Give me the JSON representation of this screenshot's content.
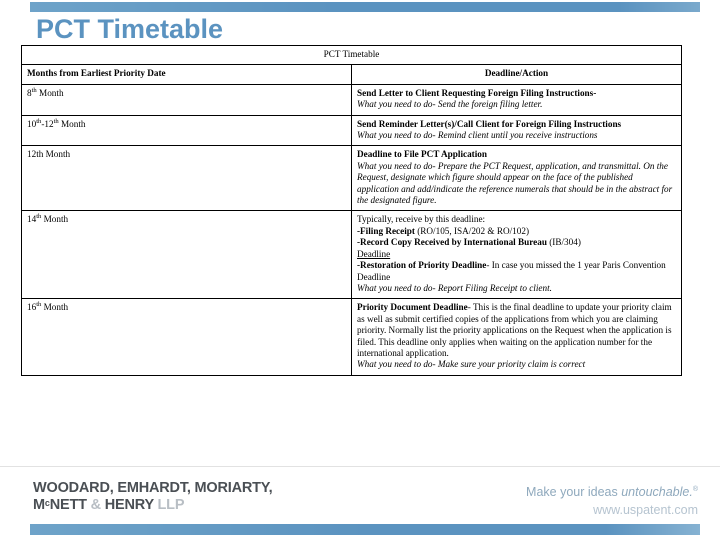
{
  "slide": {
    "title": "PCT Timetable",
    "accent_color": "#5b93c0"
  },
  "table": {
    "caption": "PCT Timetable",
    "headers": {
      "col1": "Months from Earliest Priority Date",
      "col2": "Deadline/Action"
    },
    "rows": [
      {
        "month_num": "8",
        "month_sup": "th",
        "month_suffix": " Month",
        "bold_heading": "Send Letter to Client Requesting Foreign Filing Instructions-",
        "italic_line": "What you need to do- Send the foreign filing letter."
      },
      {
        "month_num": "10",
        "month_sup": "th",
        "month_num2": "-12",
        "month_sup2": "th",
        "month_suffix": " Month",
        "bold_heading": "Send Reminder Letter(s)/Call Client for Foreign Filing Instructions",
        "italic_line": "What you need to do- Remind client until you receive instructions"
      },
      {
        "month_num": "12th",
        "month_suffix": " Month",
        "bold_heading": "Deadline to File PCT Application",
        "italic_line": "What you need to do- Prepare the PCT Request, application, and transmittal.  On the Request, designate which figure should appear on the face of the published application and add/indicate the reference numerals that should be in the abstract for the designated figure."
      },
      {
        "month_num": "14",
        "month_sup": "th",
        "month_suffix": " Month",
        "intro_line": "Typically, receive by this deadline:",
        "item1_bold": "-Filing Receipt",
        "item1_rest": " (RO/105, ISA/202 & RO/102)",
        "item2_bold": "-Record Copy Received by International Bureau",
        "item2_rest": " (IB/304)",
        "underlined_label": "Deadline",
        "item3_bold": "-Restoration of Priority Deadline",
        "item3_rest": "- In case you missed the 1 year Paris Convention Deadline",
        "italic_line": "What you need to do- Report Filing Receipt to client."
      },
      {
        "month_num": "16",
        "month_sup": "th",
        "month_suffix": " Month",
        "bold_heading": "Priority Document Deadline",
        "heading_rest": "- This is the final deadline to update your priority claim as well as submit certified copies of the applications from which you are claiming priority.  Normally list the priority applications on the Request when the application is filed. This deadline only applies when waiting on the application number for the international application.",
        "italic_line": "What you need to do- Make sure your priority claim is correct"
      }
    ]
  },
  "footer": {
    "firm_line1_a": "WOODARD, EMHARDT, MORIARTY,",
    "firm_line2_a": "M",
    "firm_line2_sup": "c",
    "firm_line2_b": "NETT ",
    "firm_line2_amp": "& ",
    "firm_line2_c": "HENRY ",
    "firm_line2_llp": "LLP",
    "tagline_plain": "Make your ideas ",
    "tagline_italic": "untouchable.",
    "website": "www.uspatent.com"
  }
}
